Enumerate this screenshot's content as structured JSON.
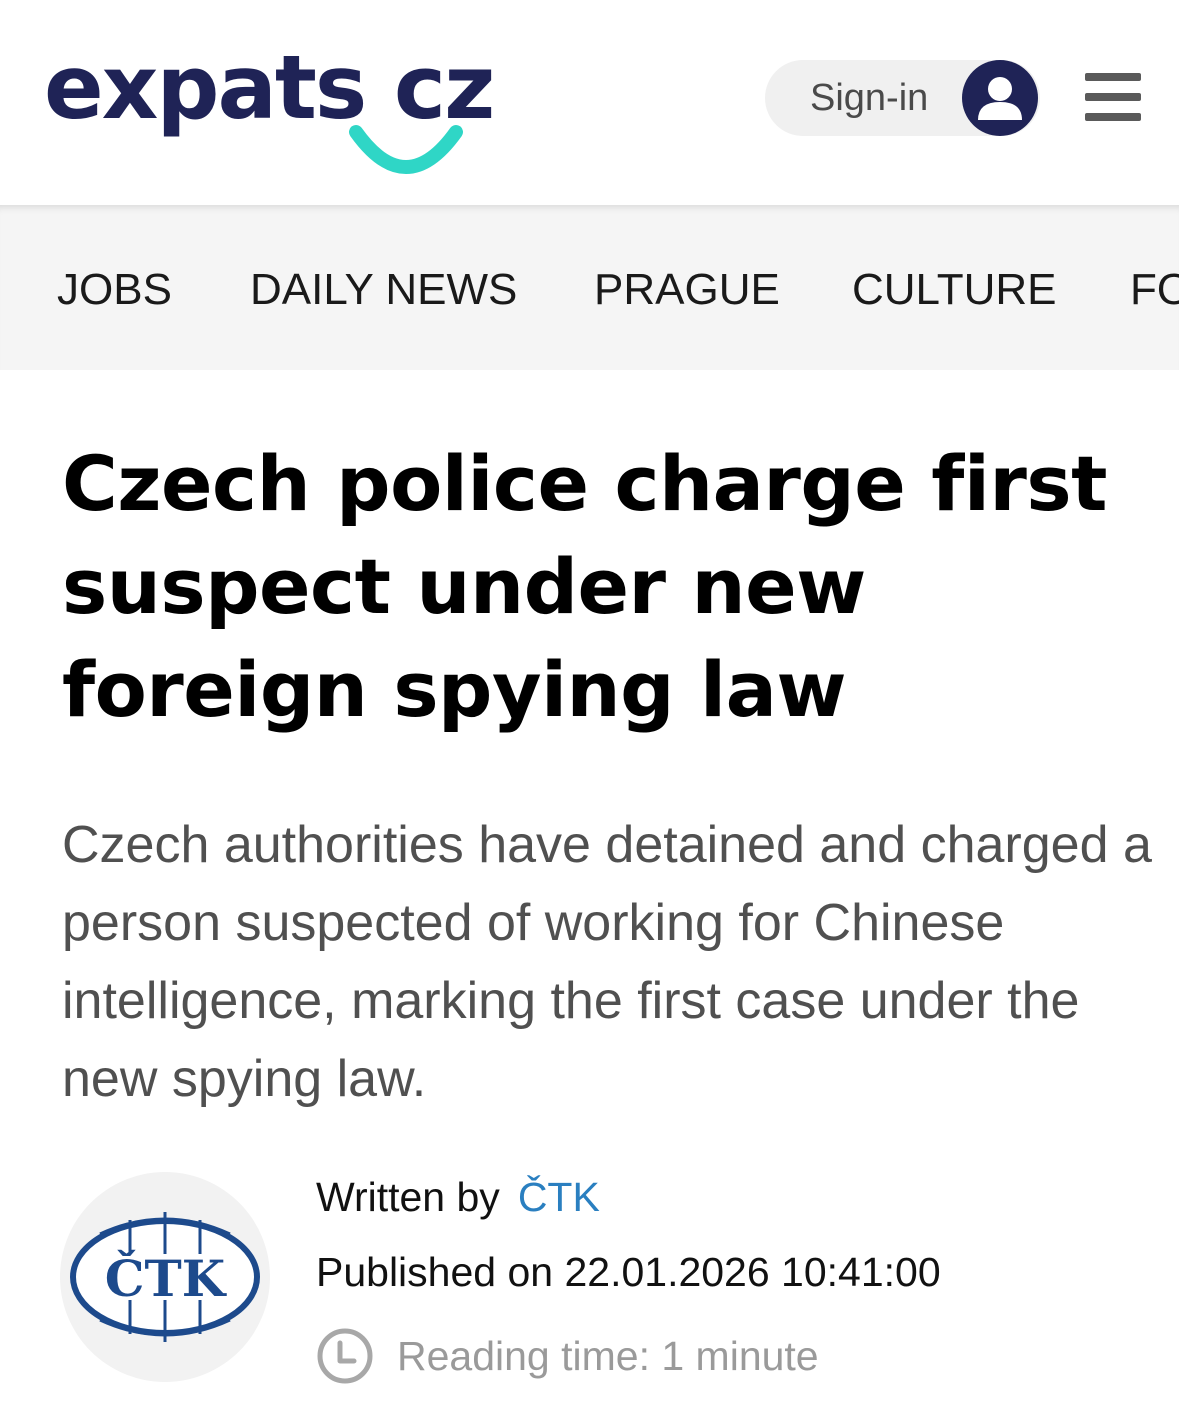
{
  "header": {
    "logo_text": "expats  cz",
    "signin_label": "Sign-in"
  },
  "nav": {
    "items": [
      "JOBS",
      "DAILY NEWS",
      "PRAGUE",
      "CULTURE",
      "FO"
    ]
  },
  "article": {
    "headline": "Czech police charge first suspect under new foreign spying law",
    "lead": "Czech authorities have detained and charged a person suspected of working for Chinese intelligence, marking the first case under the new spying law.",
    "written_by_label": "Written by",
    "author": "ČTK",
    "published": "Published on 22.01.2026 10:41:00",
    "reading_time": "Reading time: 1 minute",
    "author_logo_text": "ČTK"
  },
  "colors": {
    "brand_navy": "#1f2356",
    "brand_teal": "#2fd6c6",
    "link_blue": "#2a7fc0",
    "ctk_blue": "#1d4a8c"
  }
}
